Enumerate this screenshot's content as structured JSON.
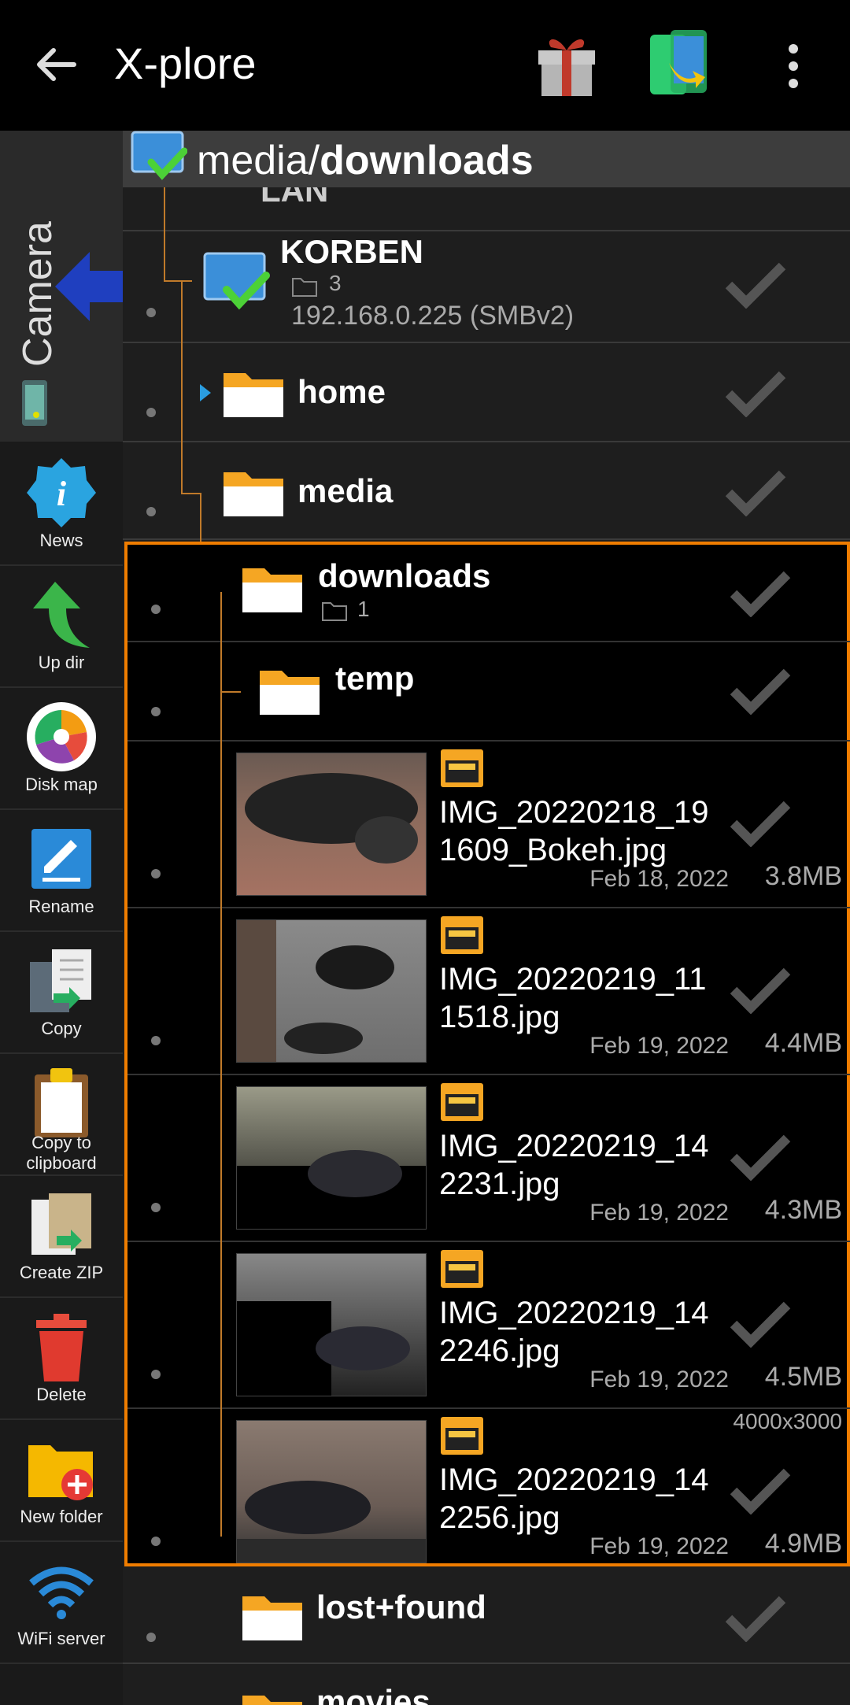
{
  "appbar": {
    "title": "X-plore"
  },
  "sidebar": {
    "camera_tab": "Camera",
    "tools": [
      {
        "label": "News"
      },
      {
        "label": "Up dir"
      },
      {
        "label": "Disk map"
      },
      {
        "label": "Rename"
      },
      {
        "label": "Copy"
      },
      {
        "label": "Copy to clipboard"
      },
      {
        "label": "Create ZIP"
      },
      {
        "label": "Delete"
      },
      {
        "label": "New folder"
      },
      {
        "label": "WiFi server"
      }
    ]
  },
  "path": {
    "prefix": "media/",
    "current": "downloads"
  },
  "tree": {
    "lan_partial": "LAN",
    "server": {
      "name": "KORBEN",
      "count": "3",
      "address": "192.168.0.225 (SMBv2)"
    },
    "folders": [
      {
        "name": "home"
      },
      {
        "name": "media"
      },
      {
        "name": "downloads",
        "count": "1"
      },
      {
        "name": "temp"
      }
    ],
    "files": [
      {
        "name_line1": "IMG_20220218_19",
        "name_line2": "1609_Bokeh.jpg",
        "date": "Feb 18, 2022",
        "size": "3.8MB"
      },
      {
        "name_line1": "IMG_20220219_11",
        "name_line2": "1518.jpg",
        "date": "Feb 19, 2022",
        "size": "4.4MB"
      },
      {
        "name_line1": "IMG_20220219_14",
        "name_line2": "2231.jpg",
        "date": "Feb 19, 2022",
        "size": "4.3MB"
      },
      {
        "name_line1": "IMG_20220219_14",
        "name_line2": "2246.jpg",
        "date": "Feb 19, 2022",
        "size": "4.5MB"
      },
      {
        "name_line1": "IMG_20220219_14",
        "name_line2": "2256.jpg",
        "date": "Feb 19, 2022",
        "size": "4.9MB",
        "dimensions": "4000x3000"
      }
    ],
    "lower_folders": [
      {
        "name": "lost+found"
      },
      {
        "name": "movies"
      }
    ]
  },
  "colors": {
    "accent": "#f07d00",
    "tree_line": "#c07a2a",
    "folder": "#f5a623",
    "check": "#555555"
  }
}
